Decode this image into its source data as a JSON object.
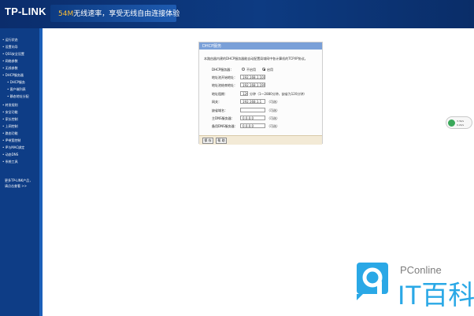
{
  "header": {
    "logo": "TP-LINK",
    "tagline_highlight": "54M",
    "tagline_rest": "无线速率，享受无线自由连接体验"
  },
  "sidebar": {
    "items": [
      {
        "label": "• 运行状态",
        "sub": false
      },
      {
        "label": "• 设置向导",
        "sub": false
      },
      {
        "label": "• QSS安全设置",
        "sub": false
      },
      {
        "label": "• 网络参数",
        "sub": false
      },
      {
        "label": "• 无线参数",
        "sub": false
      },
      {
        "label": "• DHCP服务器",
        "sub": false
      },
      {
        "label": "• DHCP服务",
        "sub": true
      },
      {
        "label": "• 客户端列表",
        "sub": true
      },
      {
        "label": "• 静态地址分配",
        "sub": true
      },
      {
        "label": "• 转发规则",
        "sub": false
      },
      {
        "label": "• 安全功能",
        "sub": false
      },
      {
        "label": "• 家长控制",
        "sub": false
      },
      {
        "label": "• 上网控制",
        "sub": false
      },
      {
        "label": "• 路由功能",
        "sub": false
      },
      {
        "label": "• IP带宽控制",
        "sub": false
      },
      {
        "label": "• IP与MAC绑定",
        "sub": false
      },
      {
        "label": "• 动态DNS",
        "sub": false
      },
      {
        "label": "• 系统工具",
        "sub": false
      }
    ],
    "links": [
      {
        "label": "更多TP-LINK产品，"
      },
      {
        "label": "请点击查看 >>"
      }
    ]
  },
  "dialog": {
    "title": "DHCP服务",
    "description": "本路由器内建的DHCP服务器能自动配置局域网中各计算机的TCP/IP协议。",
    "server_label": "DHCP服务器：",
    "radio_disable": "不启用",
    "radio_enable": "启用",
    "start_label": "地址池开始地址：",
    "start_value": "192.168.1.100",
    "end_label": "地址池结束地址：",
    "end_value": "192.168.1.199",
    "lease_label": "地址租期：",
    "lease_value": "120",
    "lease_note": "分钟（1～2880分钟，缺省为120分钟）",
    "gateway_label": "网关：",
    "gateway_value": "192.168.1.1",
    "optional": "（可选）",
    "domain_label": "缺省域名：",
    "domain_value": "",
    "dns1_label": "主DNS服务器：",
    "dns1_value": "0.0.0.0",
    "dns2_label": "备用DNS服务器：",
    "dns2_value": "0.0.0.0",
    "save_button": "保 存",
    "help_button": "帮 助"
  },
  "widget": {
    "line1": "3.3k/s",
    "line2": "0.2k/s"
  },
  "watermark": {
    "brand": "PConline",
    "name": "IT百科"
  },
  "colors": {
    "header_bg": "#0b2d6c",
    "sidebar_bg": "#0e3d86",
    "dialog_title_bg": "#7aa0d8",
    "dialog_footer_bg": "#f3ead6",
    "watermark_blue": "#2aa8e6"
  },
  "icons": {
    "widget": "network-monitor-icon",
    "watermark": "pconline-logo-icon"
  }
}
